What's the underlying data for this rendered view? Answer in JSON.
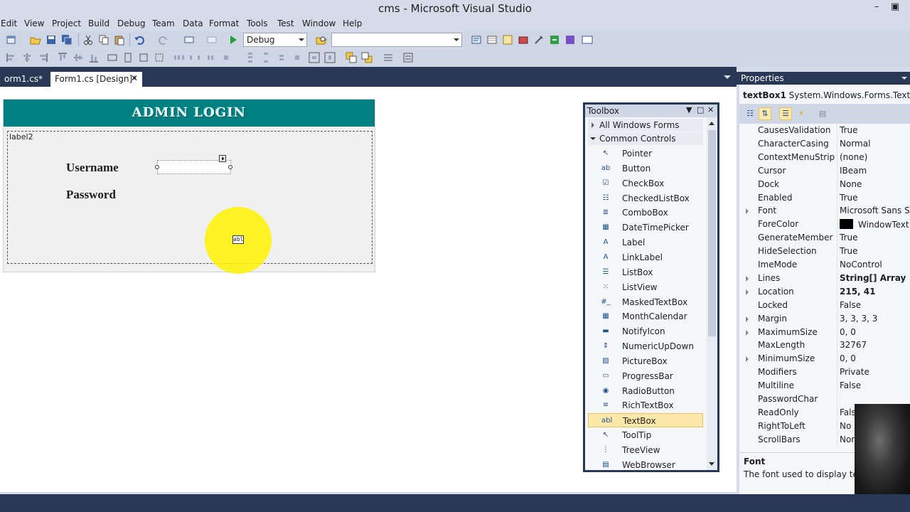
{
  "window": {
    "title": "cms - Microsoft Visual Studio",
    "minimize": "–",
    "restore": "▣"
  },
  "menu": [
    "Edit",
    "View",
    "Project",
    "Build",
    "Debug",
    "Team",
    "Data",
    "Format",
    "Tools",
    "Test",
    "Window",
    "Help"
  ],
  "toolbar": {
    "config_value": "Debug",
    "platform_value": "",
    "start_icon": "play-icon"
  },
  "doc_tabs": {
    "tab1": "orm1.cs*",
    "tab2": "Form1.cs [Design]*",
    "close": "✕"
  },
  "form": {
    "banner_title": "ADMIN LOGIN",
    "label2": "label2",
    "username_label": "Username",
    "password_label": "Password",
    "drag_icon_text": "abl",
    "banner_color": "#008080"
  },
  "toolbox": {
    "title": "Toolbox",
    "pin": "▼",
    "maximize": "□",
    "close": "✕",
    "categories": [
      "All Windows Forms",
      "Common Controls"
    ],
    "items": [
      {
        "name": "Pointer",
        "icon": "pointer-icon",
        "glyph": "↖"
      },
      {
        "name": "Button",
        "icon": "button-icon",
        "glyph": "ab"
      },
      {
        "name": "CheckBox",
        "icon": "checkbox-icon",
        "glyph": "☑"
      },
      {
        "name": "CheckedListBox",
        "icon": "checkedlistbox-icon",
        "glyph": "☷"
      },
      {
        "name": "ComboBox",
        "icon": "combobox-icon",
        "glyph": "≣"
      },
      {
        "name": "DateTimePicker",
        "icon": "datetimepicker-icon",
        "glyph": "▦"
      },
      {
        "name": "Label",
        "icon": "label-icon",
        "glyph": "A"
      },
      {
        "name": "LinkLabel",
        "icon": "linklabel-icon",
        "glyph": "A"
      },
      {
        "name": "ListBox",
        "icon": "listbox-icon",
        "glyph": "☰"
      },
      {
        "name": "ListView",
        "icon": "listview-icon",
        "glyph": "⁙"
      },
      {
        "name": "MaskedTextBox",
        "icon": "maskedtextbox-icon",
        "glyph": "#_"
      },
      {
        "name": "MonthCalendar",
        "icon": "monthcalendar-icon",
        "glyph": "▦"
      },
      {
        "name": "NotifyIcon",
        "icon": "notifyicon-icon",
        "glyph": "▬"
      },
      {
        "name": "NumericUpDown",
        "icon": "numericupdown-icon",
        "glyph": "⇕"
      },
      {
        "name": "PictureBox",
        "icon": "picturebox-icon",
        "glyph": "▨"
      },
      {
        "name": "ProgressBar",
        "icon": "progressbar-icon",
        "glyph": "▭"
      },
      {
        "name": "RadioButton",
        "icon": "radiobutton-icon",
        "glyph": "◉"
      },
      {
        "name": "RichTextBox",
        "icon": "richtextbox-icon",
        "glyph": "≡"
      },
      {
        "name": "TextBox",
        "icon": "textbox-icon",
        "glyph": "abl"
      },
      {
        "name": "ToolTip",
        "icon": "tooltip-icon",
        "glyph": "↖"
      },
      {
        "name": "TreeView",
        "icon": "treeview-icon",
        "glyph": "⋮"
      },
      {
        "name": "WebBrowser",
        "icon": "webbrowser-icon",
        "glyph": "▤"
      }
    ],
    "selected": "TextBox"
  },
  "properties": {
    "title": "Properties",
    "object_name": "textBox1",
    "object_type": "System.Windows.Forms.TextBox",
    "rows": [
      {
        "name": "CausesValidation",
        "value": "True"
      },
      {
        "name": "CharacterCasing",
        "value": "Normal"
      },
      {
        "name": "ContextMenuStrip",
        "value": "(none)"
      },
      {
        "name": "Cursor",
        "value": "IBeam"
      },
      {
        "name": "Dock",
        "value": "None"
      },
      {
        "name": "Enabled",
        "value": "True"
      },
      {
        "name": "Font",
        "value": "Microsoft Sans Seri",
        "expandable": true
      },
      {
        "name": "ForeColor",
        "value": "WindowText",
        "swatch": "#000000"
      },
      {
        "name": "GenerateMember",
        "value": "True"
      },
      {
        "name": "HideSelection",
        "value": "True"
      },
      {
        "name": "ImeMode",
        "value": "NoControl"
      },
      {
        "name": "Lines",
        "value": "String[] Array",
        "expandable": true,
        "bold": true
      },
      {
        "name": "Location",
        "value": "215, 41",
        "expandable": true,
        "bold": true
      },
      {
        "name": "Locked",
        "value": "False"
      },
      {
        "name": "Margin",
        "value": "3, 3, 3, 3",
        "expandable": true
      },
      {
        "name": "MaximumSize",
        "value": "0, 0",
        "expandable": true
      },
      {
        "name": "MaxLength",
        "value": "32767"
      },
      {
        "name": "MinimumSize",
        "value": "0, 0",
        "expandable": true
      },
      {
        "name": "Modifiers",
        "value": "Private"
      },
      {
        "name": "Multiline",
        "value": "False"
      },
      {
        "name": "PasswordChar",
        "value": ""
      },
      {
        "name": "ReadOnly",
        "value": "Fals"
      },
      {
        "name": "RightToLeft",
        "value": "No"
      },
      {
        "name": "ScrollBars",
        "value": "Nor"
      }
    ],
    "desc_title": "Font",
    "desc_text": "The font used to display text i"
  }
}
